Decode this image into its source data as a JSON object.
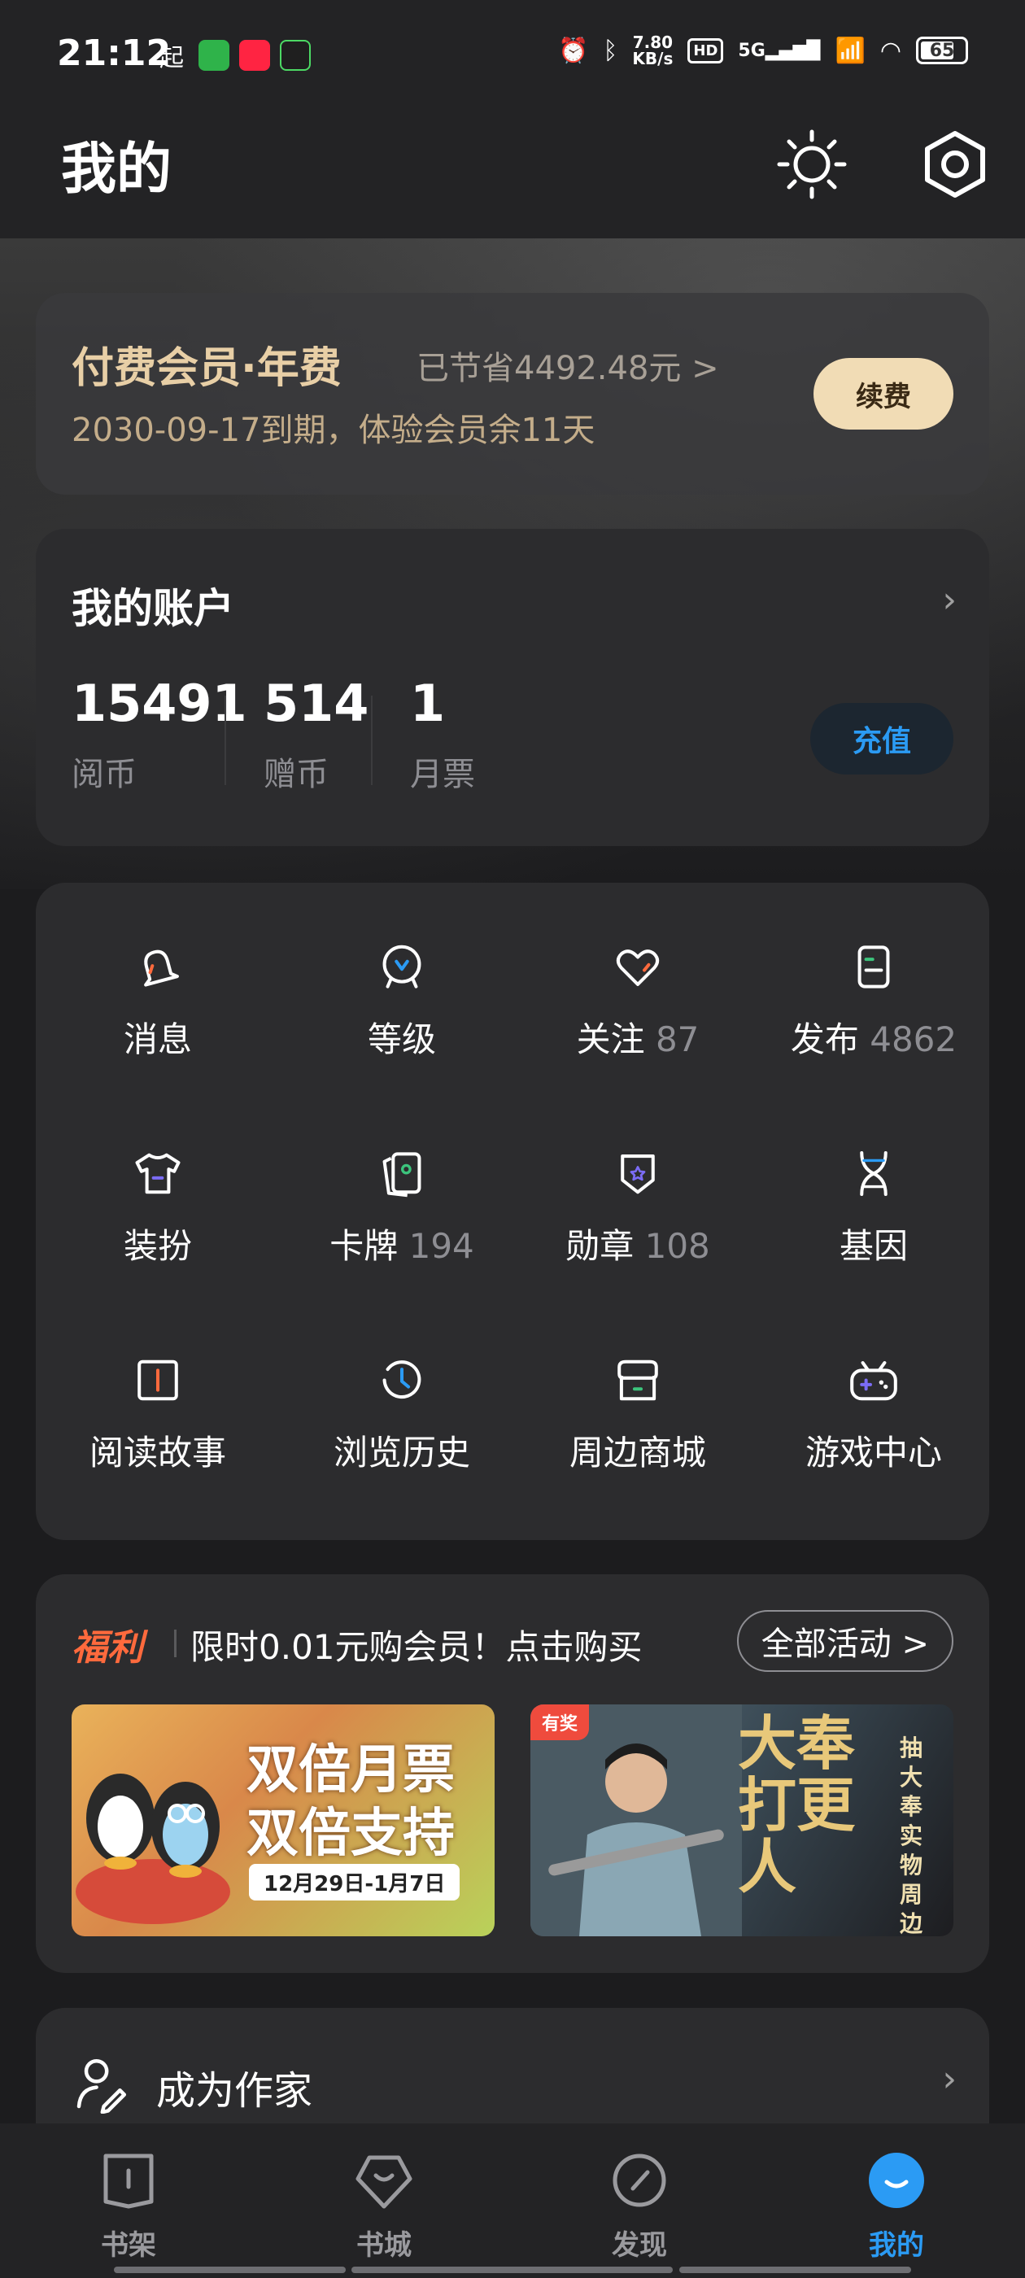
{
  "status_bar": {
    "time": "21:12",
    "qi_char": "起",
    "net_speed_top": "7.80",
    "net_speed_bottom": "KB/s",
    "hd": "HD",
    "signal": "5G",
    "battery": "65"
  },
  "header": {
    "title": "我的",
    "icons": [
      "brightness-icon",
      "settings-icon"
    ]
  },
  "member": {
    "title": "付费会员·年费",
    "saved": "已节省4492.48元 >",
    "expire": "2030-09-17到期，体验会员余11天",
    "renew_label": "续费"
  },
  "account": {
    "title": "我的账户",
    "stats": [
      {
        "value": "15491",
        "label": "阅币"
      },
      {
        "value": "514",
        "label": "赠币"
      },
      {
        "value": "1",
        "label": "月票"
      }
    ],
    "recharge_label": "充值"
  },
  "grid": [
    {
      "label": "消息",
      "count": ""
    },
    {
      "label": "等级",
      "count": ""
    },
    {
      "label": "关注",
      "count": "87"
    },
    {
      "label": "发布",
      "count": "4862"
    },
    {
      "label": "装扮",
      "count": ""
    },
    {
      "label": "卡牌",
      "count": "194"
    },
    {
      "label": "勋章",
      "count": "108"
    },
    {
      "label": "基因",
      "count": ""
    },
    {
      "label": "阅读故事",
      "count": ""
    },
    {
      "label": "浏览历史",
      "count": ""
    },
    {
      "label": "周边商城",
      "count": ""
    },
    {
      "label": "游戏中心",
      "count": ""
    }
  ],
  "welfare": {
    "tag": "福利",
    "promo": "限时0.01元购会员！点击购买",
    "all_label": "全部活动 >",
    "banner1": {
      "line1": "双倍月票",
      "line2": "双倍支持",
      "date": "12月29日-1月7日"
    },
    "banner2": {
      "badge": "有奖",
      "title": "大奉打更人",
      "side": "抽大奉实物周边"
    }
  },
  "writer": {
    "label": "成为作家"
  },
  "nav": [
    {
      "label": "书架"
    },
    {
      "label": "书城"
    },
    {
      "label": "发现"
    },
    {
      "label": "我的"
    }
  ],
  "colors": {
    "accent_blue": "#2b9bf4",
    "gold": "#e8cfa6",
    "card_bg": "#2c2c2e",
    "welfare_orange": "#ff6a3d"
  }
}
